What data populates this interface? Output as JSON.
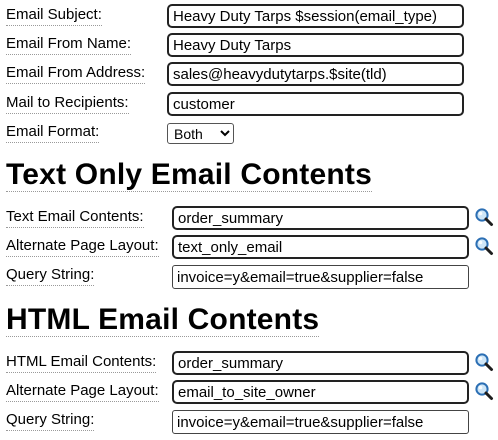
{
  "email": {
    "subject_label": "Email Subject:",
    "subject_value": "Heavy Duty Tarps $session(email_type)",
    "from_name_label": "Email From Name:",
    "from_name_value": "Heavy Duty Tarps",
    "from_address_label": "Email From Address:",
    "from_address_value": "sales@heavydutytarps.$site(tld)",
    "recipients_label": "Mail to Recipients:",
    "recipients_value": "customer",
    "format_label": "Email Format:",
    "format_value": "Both"
  },
  "text_section": {
    "heading": "Text Only Email Contents",
    "contents_label": "Text Email Contents:",
    "contents_value": "order_summary",
    "layout_label": "Alternate Page Layout:",
    "layout_value": "text_only_email",
    "query_label": "Query String:",
    "query_value": "invoice=y&email=true&supplier=false"
  },
  "html_section": {
    "heading": "HTML Email Contents",
    "contents_label": "HTML Email Contents:",
    "contents_value": "order_summary",
    "layout_label": "Alternate Page Layout:",
    "layout_value": "email_to_site_owner",
    "query_label": "Query String:",
    "query_value": "invoice=y&email=true&supplier=false"
  },
  "icons": {
    "lookup": "magnifier-icon"
  }
}
